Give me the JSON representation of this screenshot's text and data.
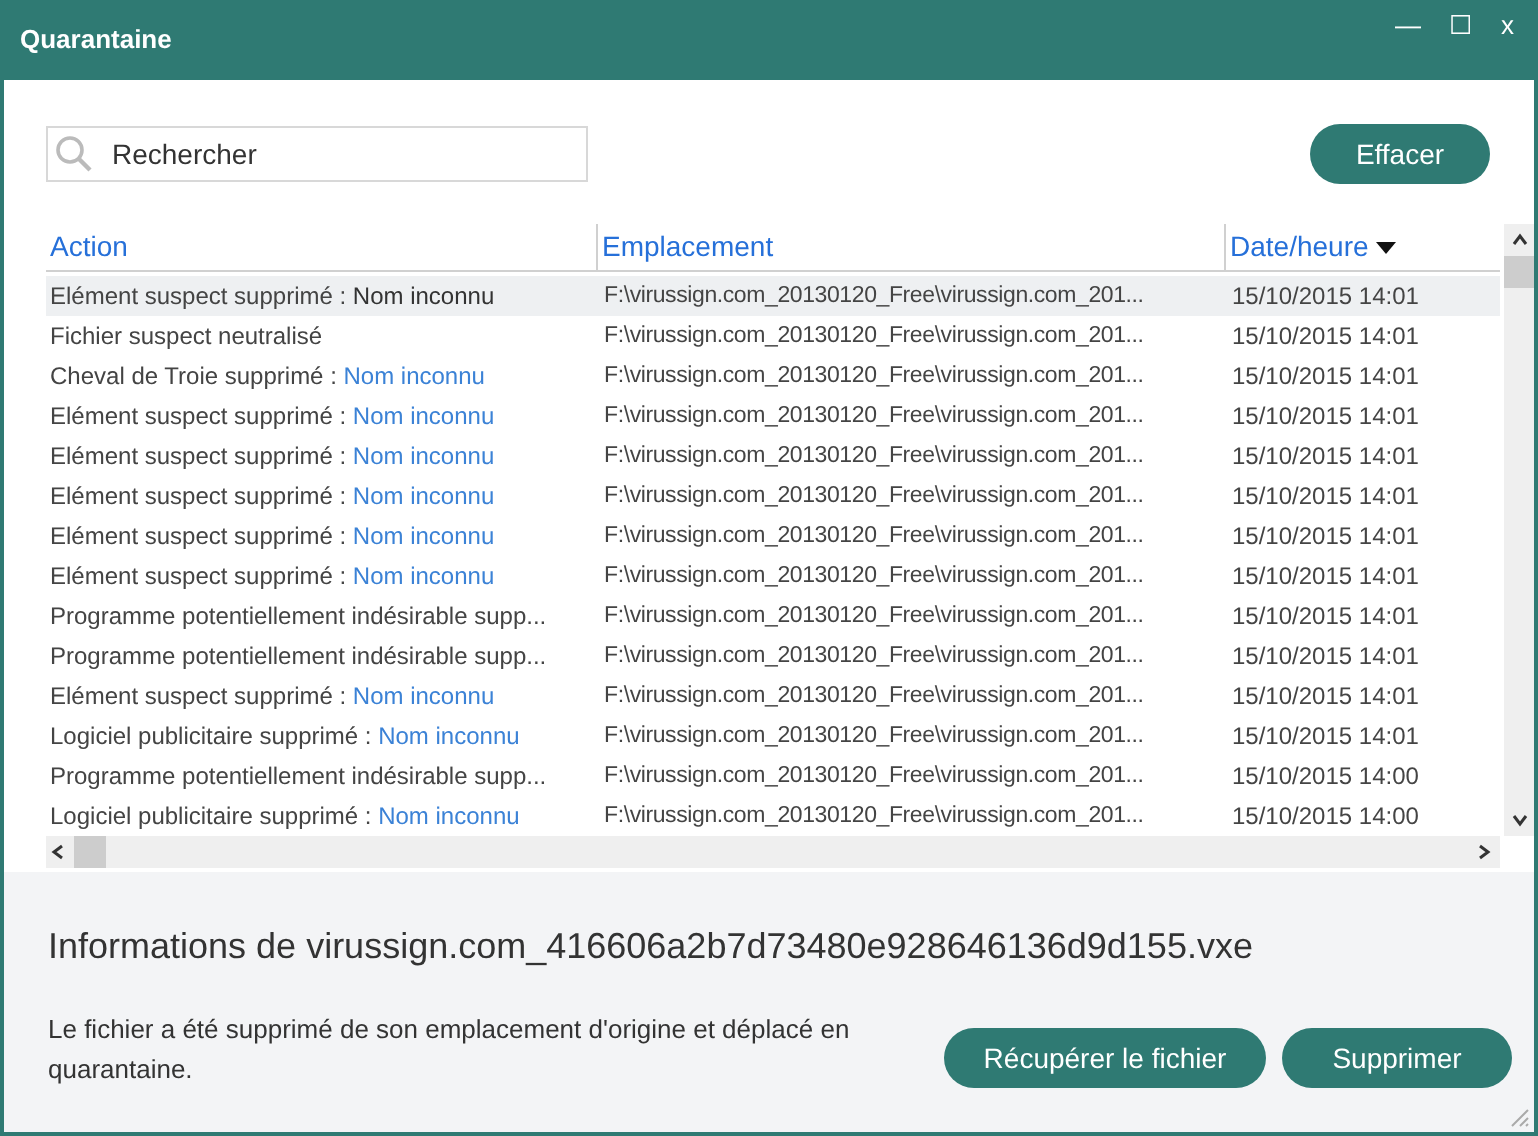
{
  "window": {
    "title": "Quarantaine",
    "controls": [
      "—",
      "☐",
      "x"
    ]
  },
  "search": {
    "placeholder": "Rechercher"
  },
  "clear_button": "Effacer",
  "table": {
    "columns": [
      {
        "label": "Action",
        "sorted": false
      },
      {
        "label": "Emplacement",
        "sorted": false
      },
      {
        "label": "Date/heure",
        "sorted": true
      }
    ],
    "rows": [
      {
        "action": "Elément suspect supprimé : ",
        "name": "Nom inconnu",
        "location": "F:\\virussign.com_20130120_Free\\virussign.com_201...",
        "date": "15/10/2015 14:01",
        "selected": true
      },
      {
        "action": "Fichier suspect neutralisé",
        "location": "F:\\virussign.com_20130120_Free\\virussign.com_201...",
        "date": "15/10/2015 14:01",
        "selected": false
      },
      {
        "action": "Cheval de Troie supprimé : ",
        "name": "Nom inconnu",
        "location": "F:\\virussign.com_20130120_Free\\virussign.com_201...",
        "date": "15/10/2015 14:01",
        "selected": false
      },
      {
        "action": "Elément suspect supprimé : ",
        "name": "Nom inconnu",
        "location": "F:\\virussign.com_20130120_Free\\virussign.com_201...",
        "date": "15/10/2015 14:01",
        "selected": false
      },
      {
        "action": "Elément suspect supprimé : ",
        "name": "Nom inconnu",
        "location": "F:\\virussign.com_20130120_Free\\virussign.com_201...",
        "date": "15/10/2015 14:01",
        "selected": false
      },
      {
        "action": "Elément suspect supprimé : ",
        "name": "Nom inconnu",
        "location": "F:\\virussign.com_20130120_Free\\virussign.com_201...",
        "date": "15/10/2015 14:01",
        "selected": false
      },
      {
        "action": "Elément suspect supprimé : ",
        "name": "Nom inconnu",
        "location": "F:\\virussign.com_20130120_Free\\virussign.com_201...",
        "date": "15/10/2015 14:01",
        "selected": false
      },
      {
        "action": "Elément suspect supprimé : ",
        "name": "Nom inconnu",
        "location": "F:\\virussign.com_20130120_Free\\virussign.com_201...",
        "date": "15/10/2015 14:01",
        "selected": false
      },
      {
        "action": "Programme potentiellement indésirable supp...",
        "location": "F:\\virussign.com_20130120_Free\\virussign.com_201...",
        "date": "15/10/2015 14:01",
        "selected": false
      },
      {
        "action": "Programme potentiellement indésirable supp...",
        "location": "F:\\virussign.com_20130120_Free\\virussign.com_201...",
        "date": "15/10/2015 14:01",
        "selected": false
      },
      {
        "action": "Elément suspect supprimé : ",
        "name": "Nom inconnu",
        "location": "F:\\virussign.com_20130120_Free\\virussign.com_201...",
        "date": "15/10/2015 14:01",
        "selected": false
      },
      {
        "action": "Logiciel publicitaire supprimé : ",
        "name": "Nom inconnu",
        "location": "F:\\virussign.com_20130120_Free\\virussign.com_201...",
        "date": "15/10/2015 14:01",
        "selected": false
      },
      {
        "action": "Programme potentiellement indésirable supp...",
        "location": "F:\\virussign.com_20130120_Free\\virussign.com_201...",
        "date": "15/10/2015 14:00",
        "selected": false
      },
      {
        "action": "Logiciel publicitaire supprimé : ",
        "name": "Nom inconnu",
        "location": "F:\\virussign.com_20130120_Free\\virussign.com_201...",
        "date": "15/10/2015 14:00",
        "selected": false
      }
    ]
  },
  "info": {
    "title": "Informations de virussign.com_416606a2b7d73480e928646136d9d155.vxe",
    "text": "Le fichier a été supprimé de son emplacement d'origine et déplacé en quarantaine."
  },
  "buttons": [
    "Récupérer le fichier",
    "Supprimer"
  ]
}
